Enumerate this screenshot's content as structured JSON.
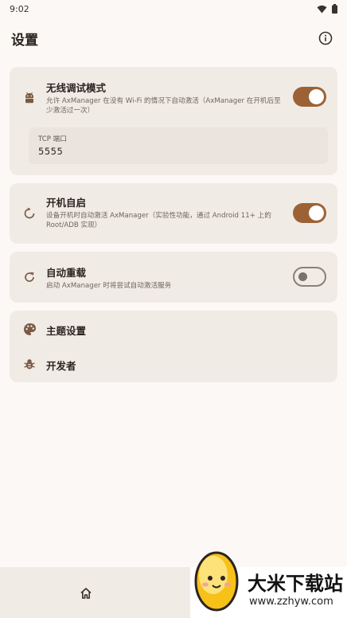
{
  "status_bar": {
    "time": "9:02"
  },
  "appbar": {
    "title": "设置"
  },
  "wireless_card": {
    "title": "无线调试模式",
    "description": "允许 AxManager 在没有 Wi-Fi 的情况下自动激活（AxManager 在开机后至少激活过一次）",
    "enabled": true,
    "tcp_port": {
      "label": "TCP 端口",
      "value": "5555"
    }
  },
  "boot_card": {
    "title": "开机自启",
    "description": "设备开机时自动激活 AxManager（实验性功能，通过 Android 11+ 上的 Root/ADB 实现）",
    "enabled": true
  },
  "reload_card": {
    "title": "自动重载",
    "description": "启动 AxManager 时将尝试自动激活服务",
    "enabled": false
  },
  "menu": {
    "theme_label": "主题设置",
    "developer_label": "开发者"
  },
  "watermark": {
    "brand": "大米下载站",
    "url": "www.zzhyw.com"
  },
  "colors": {
    "accent": "#9c6235",
    "card": "#f1ebe6",
    "background": "#fbf8f5"
  }
}
